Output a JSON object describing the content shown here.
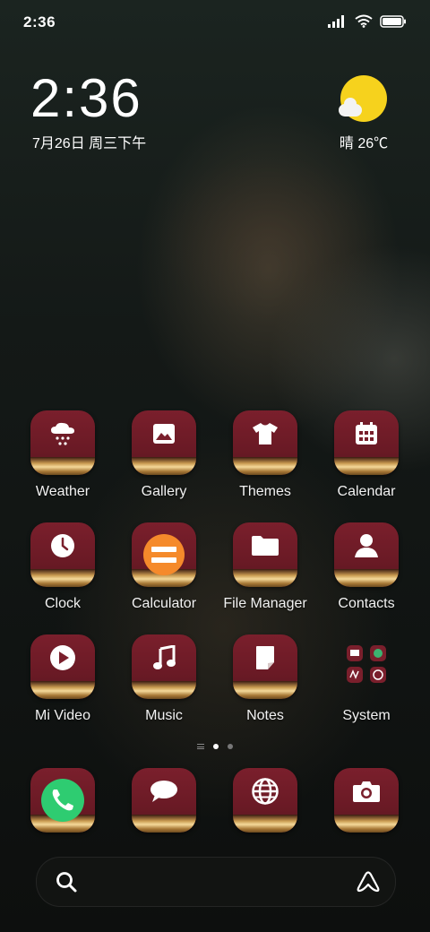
{
  "status_bar": {
    "time": "2:36"
  },
  "clock_widget": {
    "time": "2:36",
    "date": "7月26日 周三下午",
    "weather": "晴 26℃"
  },
  "apps": [
    {
      "label": "Weather",
      "icon": "weather-snow-icon"
    },
    {
      "label": "Gallery",
      "icon": "image-icon"
    },
    {
      "label": "Themes",
      "icon": "tshirt-icon"
    },
    {
      "label": "Calendar",
      "icon": "calendar-icon"
    },
    {
      "label": "Clock",
      "icon": "clock-icon"
    },
    {
      "label": "Calculator",
      "icon": "calculator-icon"
    },
    {
      "label": "File Manager",
      "icon": "folder-icon"
    },
    {
      "label": "Contacts",
      "icon": "contact-icon"
    },
    {
      "label": "Mi Video",
      "icon": "play-icon"
    },
    {
      "label": "Music",
      "icon": "music-note-icon"
    },
    {
      "label": "Notes",
      "icon": "note-icon"
    },
    {
      "label": "System",
      "icon": "folder-grid-icon"
    }
  ],
  "dock": [
    {
      "name": "Phone",
      "icon": "phone-icon"
    },
    {
      "name": "Messages",
      "icon": "message-icon"
    },
    {
      "name": "Browser",
      "icon": "globe-icon"
    },
    {
      "name": "Camera",
      "icon": "camera-icon"
    }
  ],
  "page_indicator": {
    "pages": 2,
    "current": 1
  },
  "colors": {
    "tile": "#7a1f2c",
    "sun": "#f6d21d",
    "calculator_accent": "#f58a2b",
    "phone_accent": "#2ecc71"
  }
}
